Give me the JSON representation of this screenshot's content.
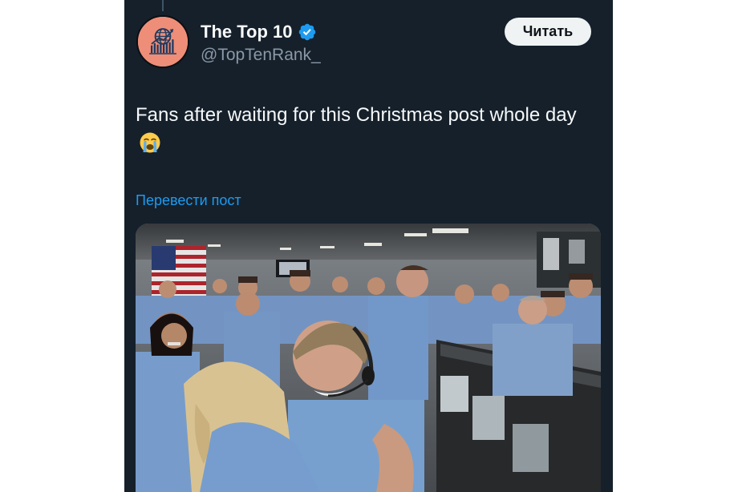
{
  "tweet": {
    "author": {
      "display_name": "The Top 10",
      "handle": "@TopTenRank_",
      "verified": true,
      "avatar_icon": "globe-chart-logo",
      "avatar_color": "#ee8e78"
    },
    "follow_label": "Читать",
    "text": "Fans after waiting for this Christmas post whole day",
    "emoji": "😭",
    "emoji_icon": "loudly-crying-face-icon",
    "translate_label": "Перевести пост",
    "media": {
      "type": "photo"
    }
  },
  "colors": {
    "background": "#15202b",
    "text": "#f7f9f9",
    "secondary_text": "#8b98a5",
    "link": "#1d9bf0",
    "verified_badge": "#1d9bf0",
    "button_bg": "#eff3f4"
  }
}
